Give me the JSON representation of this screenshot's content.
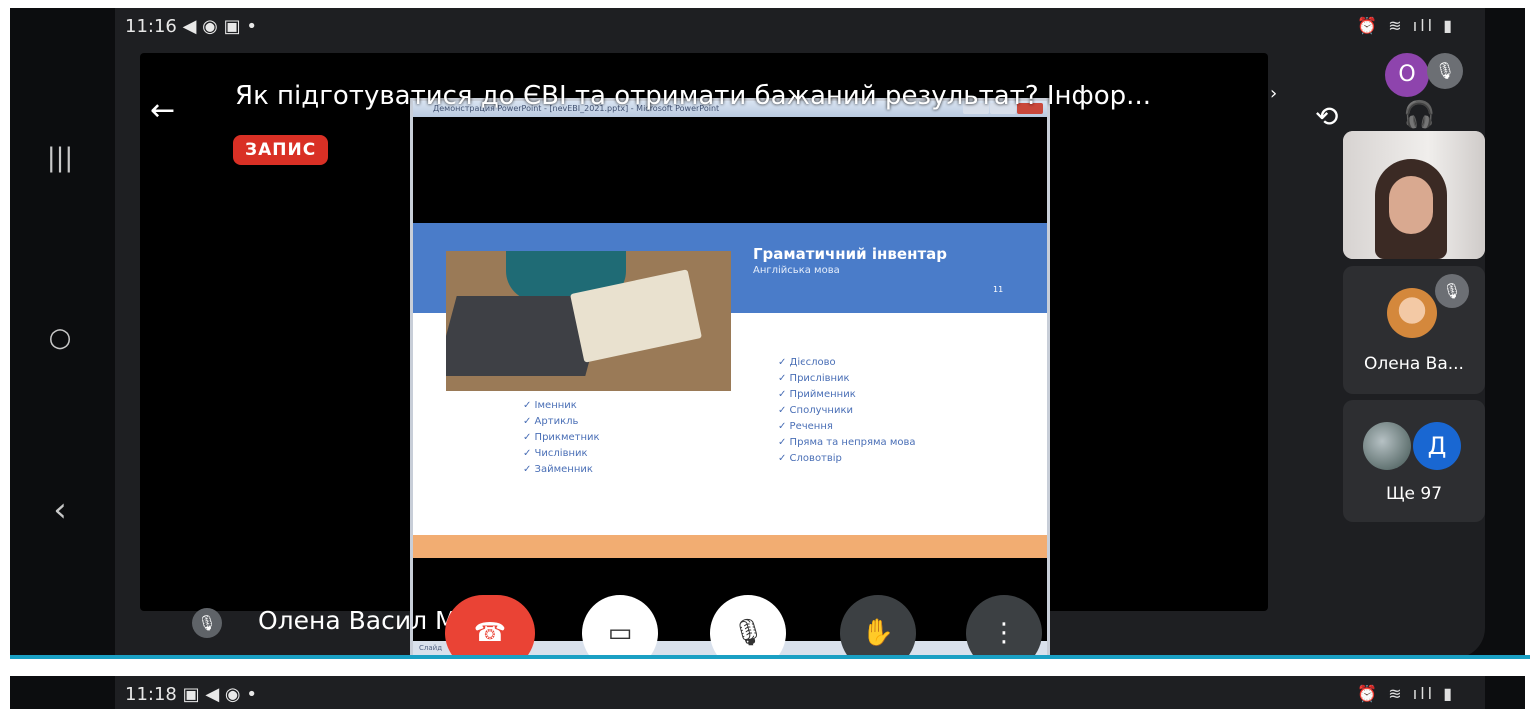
{
  "screen1": {
    "status": {
      "time": "11:16",
      "left_icons": "◀ ◉ ▣ •",
      "right_icons": "⏰ ≋ ıll ▮"
    },
    "meeting": {
      "title": "Як підготуватися до ЄВІ та отримати бажаний результат? Інфор...",
      "recording_badge": "ЗАПИС"
    },
    "slide_window": {
      "titlebar": "Демонстрация PowerPoint - [nevEBI_2021.pptx] - Microsoft PowerPoint",
      "statusbar": "Слайд",
      "slide": {
        "title": "Граматичний інвентар",
        "subtitle": "Англійська мова",
        "number": "11",
        "left_list": [
          "✓ Іменник",
          "✓ Артикль",
          "✓ Прикметник",
          "✓ Числівник",
          "✓ Займенник"
        ],
        "right_list": [
          "✓ Дієслово",
          "✓ Прислівник",
          "✓ Прийменник",
          "✓ Сполучники",
          "✓ Речення",
          "✓ Пряма та непряма мова",
          "✓ Словотвір"
        ]
      }
    },
    "speaker": {
      "name": "Олена Васил      Муд"
    },
    "participants": {
      "self_initial": "О",
      "tile_olena_name": "Олена Ва...",
      "more_initial": "Д",
      "more_label": "Ще 97"
    },
    "icons": {
      "nav_recents": "|||",
      "nav_home": "○",
      "nav_back": "‹",
      "back_arrow": "←",
      "title_caret": "›",
      "switch_camera": "⟲",
      "headphones": "🎧",
      "mic_off": "🎙",
      "hangup": "☎",
      "camera_off": "▭",
      "raise_hand": "✋",
      "more": "⋮"
    }
  },
  "screen2": {
    "status": {
      "time": "11:18",
      "left_icons": "▣ ◀ ◉ •",
      "right_icons": "⏰ ≋ ıll ▮"
    }
  },
  "colors": {
    "record_red": "#d93025",
    "hangup_red": "#ea4335",
    "slide_blue": "#4a7cc9",
    "slide_orange": "#f2ad72",
    "divider_teal": "#1aa0c4"
  }
}
